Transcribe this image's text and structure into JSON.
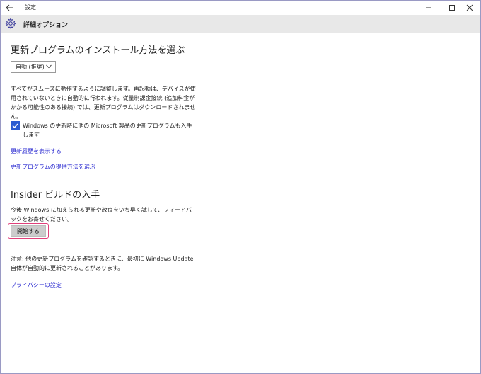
{
  "window": {
    "app_title": "設定"
  },
  "page_header": {
    "title": "詳細オプション"
  },
  "update_section": {
    "heading": "更新プログラムのインストール方法を選ぶ",
    "dropdown_value": "自動 (推奨)",
    "description": "すべてがスムーズに動作するように調整します。再起動は、デバイスが使用されていないときに自動的に行われます。従量制課金接続 (追加料金がかかる可能性のある接続) では、更新プログラムはダウンロードされません。",
    "checkbox_label": "Windows の更新時に他の Microsoft 製品の更新プログラムも入手します",
    "checkbox_checked": true,
    "link_history": "更新履歴を表示する",
    "link_delivery": "更新プログラムの提供方法を選ぶ"
  },
  "insider_section": {
    "heading": "Insider ビルドの入手",
    "description": "今後 Windows に加えられる更新や改良をいち早く試して、フィードバックをお寄せください。",
    "start_button": "開始する",
    "note": "注意: 他の更新プログラムを確認するときに、最初に Windows Update 自体が自動的に更新されることがあります。",
    "link_privacy": "プライバシーの設定"
  },
  "colors": {
    "accent": "#2a5bd1",
    "link": "#2828d0",
    "highlight": "#e0407a"
  }
}
